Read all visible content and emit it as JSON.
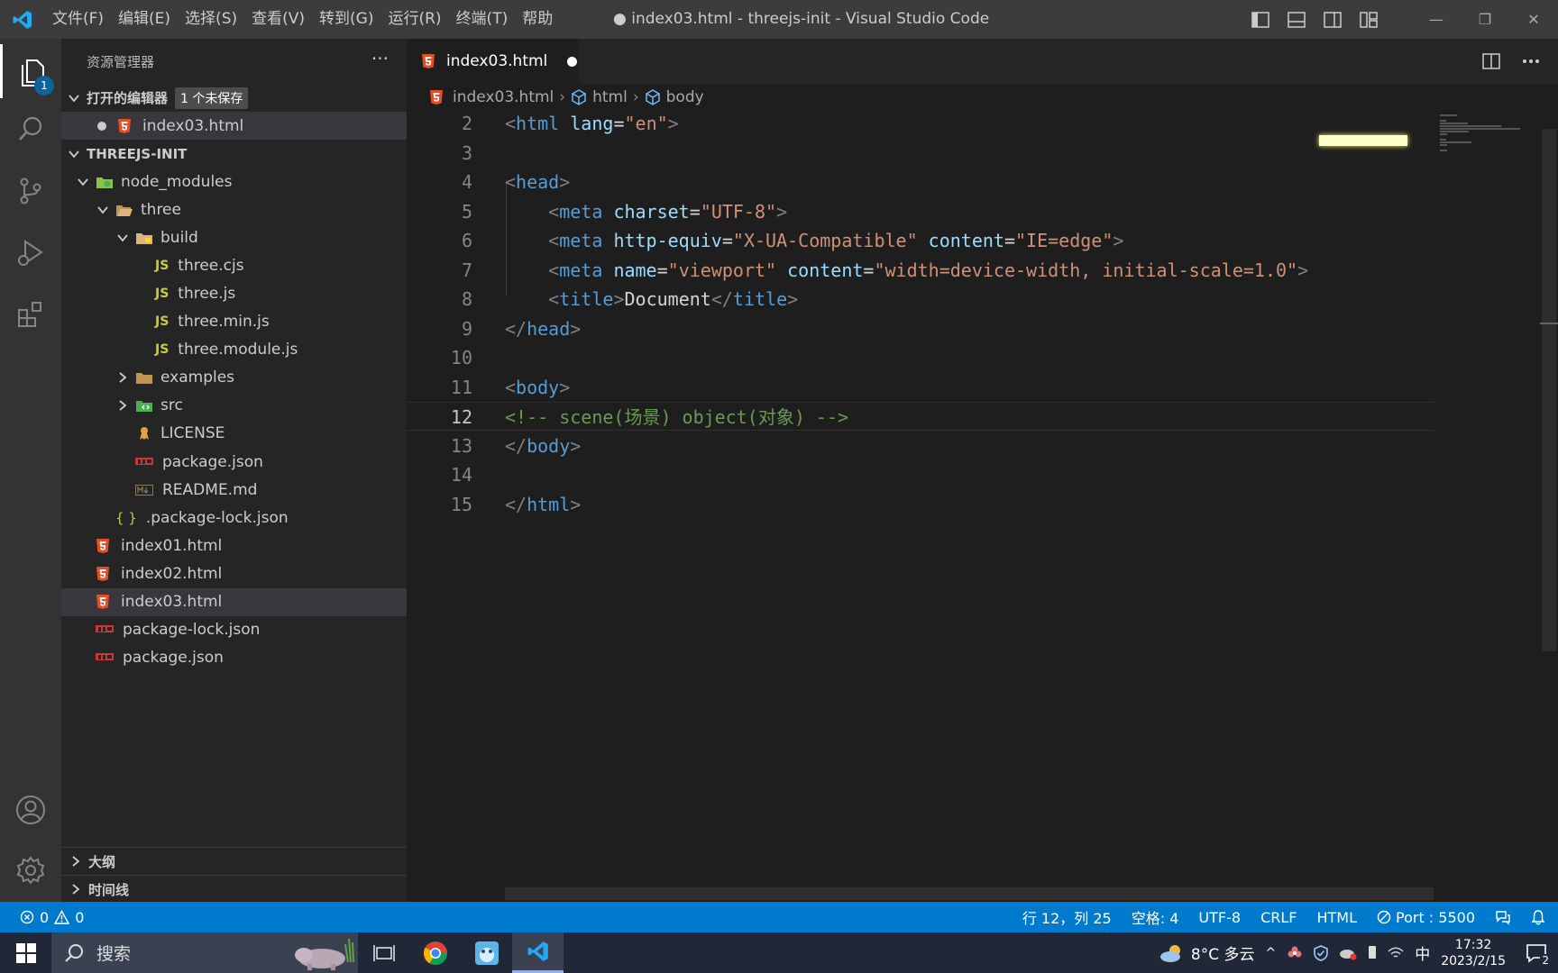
{
  "titlebar": {
    "menu": [
      "文件(F)",
      "编辑(E)",
      "选择(S)",
      "查看(V)",
      "转到(G)",
      "运行(R)",
      "终端(T)",
      "帮助"
    ],
    "title": "● index03.html - threejs-init - Visual Studio Code",
    "window_controls": [
      "—",
      "❐",
      "✕"
    ]
  },
  "activitybar": {
    "explorer_badge": "1",
    "items": [
      "files-icon",
      "search-icon",
      "source-control-icon",
      "run-debug-icon",
      "extensions-icon",
      "account-icon",
      "settings-gear-icon"
    ]
  },
  "sidebar": {
    "title": "资源管理器",
    "more": "···",
    "open_editors": {
      "label": "打开的编辑器",
      "badge": "1 个未保存",
      "files": [
        "index03.html"
      ]
    },
    "project": {
      "label": "THREEJS-INIT",
      "tree": [
        {
          "name": "node_modules",
          "kind": "folder-node",
          "depth": 1,
          "expanded": true
        },
        {
          "name": "three",
          "kind": "folder-open",
          "depth": 2,
          "expanded": true
        },
        {
          "name": "build",
          "kind": "folder-build",
          "depth": 3,
          "expanded": true
        },
        {
          "name": "three.cjs",
          "kind": "js",
          "depth": 4
        },
        {
          "name": "three.js",
          "kind": "js",
          "depth": 4
        },
        {
          "name": "three.min.js",
          "kind": "js",
          "depth": 4
        },
        {
          "name": "three.module.js",
          "kind": "js",
          "depth": 4
        },
        {
          "name": "examples",
          "kind": "folder",
          "depth": 3,
          "expanded": false
        },
        {
          "name": "src",
          "kind": "folder-src",
          "depth": 3,
          "expanded": false
        },
        {
          "name": "LICENSE",
          "kind": "license",
          "depth": 3
        },
        {
          "name": "package.json",
          "kind": "npm",
          "depth": 3
        },
        {
          "name": "README.md",
          "kind": "md",
          "depth": 3
        },
        {
          "name": ".package-lock.json",
          "kind": "json",
          "depth": 2
        },
        {
          "name": "index01.html",
          "kind": "html",
          "depth": 1
        },
        {
          "name": "index02.html",
          "kind": "html",
          "depth": 1
        },
        {
          "name": "index03.html",
          "kind": "html",
          "depth": 1,
          "selected": true
        },
        {
          "name": "package-lock.json",
          "kind": "npm",
          "depth": 1
        },
        {
          "name": "package.json",
          "kind": "npm",
          "depth": 1
        }
      ]
    },
    "outline_label": "大纲",
    "timeline_label": "时间线"
  },
  "tabs": [
    {
      "label": "index03.html",
      "dirty": true,
      "active": true
    }
  ],
  "breadcrumb": [
    "index03.html",
    "html",
    "body"
  ],
  "editor": {
    "current_line": 12,
    "lines": [
      {
        "n": "2",
        "tokens": [
          [
            "br",
            "<"
          ],
          [
            "tag",
            "html"
          ],
          [
            "txt",
            " "
          ],
          [
            "attr",
            "lang"
          ],
          [
            "txt",
            "="
          ],
          [
            "str",
            "\"en\""
          ],
          [
            "br",
            ">"
          ]
        ]
      },
      {
        "n": "3",
        "tokens": []
      },
      {
        "n": "4",
        "tokens": [
          [
            "br",
            "<"
          ],
          [
            "tag",
            "head"
          ],
          [
            "br",
            ">"
          ]
        ]
      },
      {
        "n": "5",
        "tokens": [
          [
            "txt",
            "    "
          ],
          [
            "br",
            "<"
          ],
          [
            "tag",
            "meta"
          ],
          [
            "txt",
            " "
          ],
          [
            "attr",
            "charset"
          ],
          [
            "txt",
            "="
          ],
          [
            "str",
            "\"UTF-8\""
          ],
          [
            "br",
            ">"
          ]
        ]
      },
      {
        "n": "6",
        "tokens": [
          [
            "txt",
            "    "
          ],
          [
            "br",
            "<"
          ],
          [
            "tag",
            "meta"
          ],
          [
            "txt",
            " "
          ],
          [
            "attr",
            "http-equiv"
          ],
          [
            "txt",
            "="
          ],
          [
            "str",
            "\"X-UA-Compatible\""
          ],
          [
            "txt",
            " "
          ],
          [
            "attr",
            "content"
          ],
          [
            "txt",
            "="
          ],
          [
            "str",
            "\"IE=edge\""
          ],
          [
            "br",
            ">"
          ]
        ]
      },
      {
        "n": "7",
        "tokens": [
          [
            "txt",
            "    "
          ],
          [
            "br",
            "<"
          ],
          [
            "tag",
            "meta"
          ],
          [
            "txt",
            " "
          ],
          [
            "attr",
            "name"
          ],
          [
            "txt",
            "="
          ],
          [
            "str",
            "\"viewport\""
          ],
          [
            "txt",
            " "
          ],
          [
            "attr",
            "content"
          ],
          [
            "txt",
            "="
          ],
          [
            "str",
            "\"width=device-width, initial-scale=1.0\""
          ],
          [
            "br",
            ">"
          ]
        ]
      },
      {
        "n": "8",
        "tokens": [
          [
            "txt",
            "    "
          ],
          [
            "br",
            "<"
          ],
          [
            "tag",
            "title"
          ],
          [
            "br",
            ">"
          ],
          [
            "txt",
            "Document"
          ],
          [
            "br",
            "</"
          ],
          [
            "tag",
            "title"
          ],
          [
            "br",
            ">"
          ]
        ]
      },
      {
        "n": "9",
        "tokens": [
          [
            "br",
            "</"
          ],
          [
            "tag",
            "head"
          ],
          [
            "br",
            ">"
          ]
        ]
      },
      {
        "n": "10",
        "tokens": []
      },
      {
        "n": "11",
        "tokens": [
          [
            "br",
            "<"
          ],
          [
            "tag",
            "body"
          ],
          [
            "br",
            ">"
          ]
        ]
      },
      {
        "n": "12",
        "tokens": [
          [
            "com",
            "<!-- scene(场景) object(对象) -->"
          ]
        ]
      },
      {
        "n": "13",
        "tokens": [
          [
            "br",
            "</"
          ],
          [
            "tag",
            "body"
          ],
          [
            "br",
            ">"
          ]
        ]
      },
      {
        "n": "14",
        "tokens": []
      },
      {
        "n": "15",
        "tokens": [
          [
            "br",
            "</"
          ],
          [
            "tag",
            "html"
          ],
          [
            "br",
            ">"
          ]
        ]
      }
    ]
  },
  "statusbar": {
    "errors": "0",
    "warnings": "0",
    "position": "行 12，列 25",
    "spaces": "空格: 4",
    "encoding": "UTF-8",
    "eol": "CRLF",
    "language": "HTML",
    "port": "Port : 5500"
  },
  "taskbar": {
    "search_label": "搜索",
    "weather": "8°C 多云",
    "ime": "中",
    "time": "17:32",
    "date": "2023/2/15",
    "notifications": "2"
  },
  "colors": {
    "accent": "#007acc",
    "tag": "#569cd6",
    "attr": "#9cdcfe",
    "string": "#ce9178",
    "comment": "#6a9955"
  }
}
